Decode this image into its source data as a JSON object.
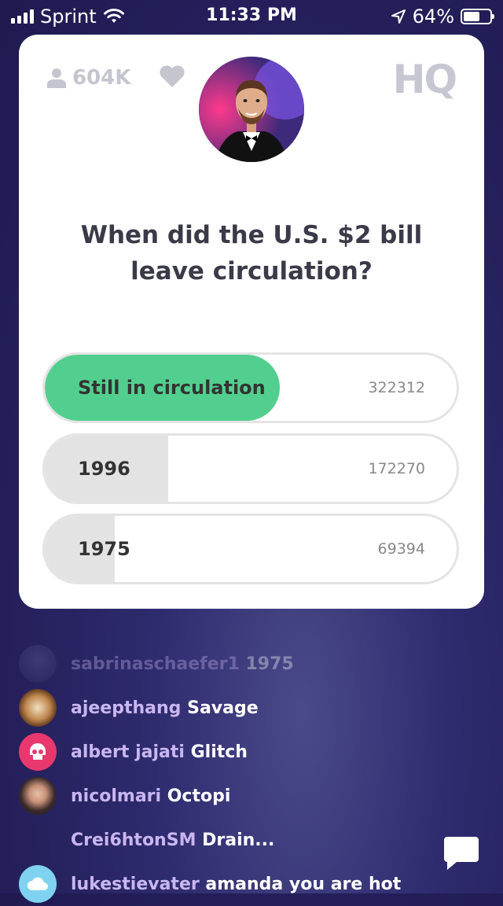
{
  "status": {
    "carrier": "Sprint",
    "time": "11:33 PM",
    "battery": "64%",
    "battery_level": 0.64
  },
  "card": {
    "viewer_count": "604K",
    "logo": "HQ",
    "question": "When did the U.S. $2 bill leave circulation?",
    "answers": [
      {
        "label": "Still in circulation",
        "count": "322312",
        "fill": 0.57,
        "correct": true
      },
      {
        "label": "1996",
        "count": "172270",
        "fill": 0.3,
        "correct": false
      },
      {
        "label": "1975",
        "count": "69394",
        "fill": 0.17,
        "correct": false
      }
    ]
  },
  "chat": [
    {
      "user": "sabrinaschaefer1",
      "message": "1975",
      "avatar": "photo-avatar"
    },
    {
      "user": "ajeepthang",
      "message": "Savage",
      "avatar": "clock-avatar"
    },
    {
      "user": "albert jajati",
      "message": "Glitch",
      "avatar": "skull-avatar",
      "avatar_color": "#e8386e"
    },
    {
      "user": "nicolmari",
      "message": "Octopi",
      "avatar": "photo-avatar"
    },
    {
      "user": "Crei6htonSM",
      "message": "Drain...",
      "avatar": "none"
    },
    {
      "user": "lukestievater",
      "message": "amanda you are hot",
      "avatar": "cloud-avatar",
      "avatar_color": "#7fd3f0"
    }
  ],
  "colors": {
    "correct": "#52cf8e",
    "background": "#241f5a"
  },
  "icons": [
    "wifi-icon",
    "location-arrow-icon",
    "person-icon",
    "heart-icon",
    "chat-bubble-icon"
  ]
}
